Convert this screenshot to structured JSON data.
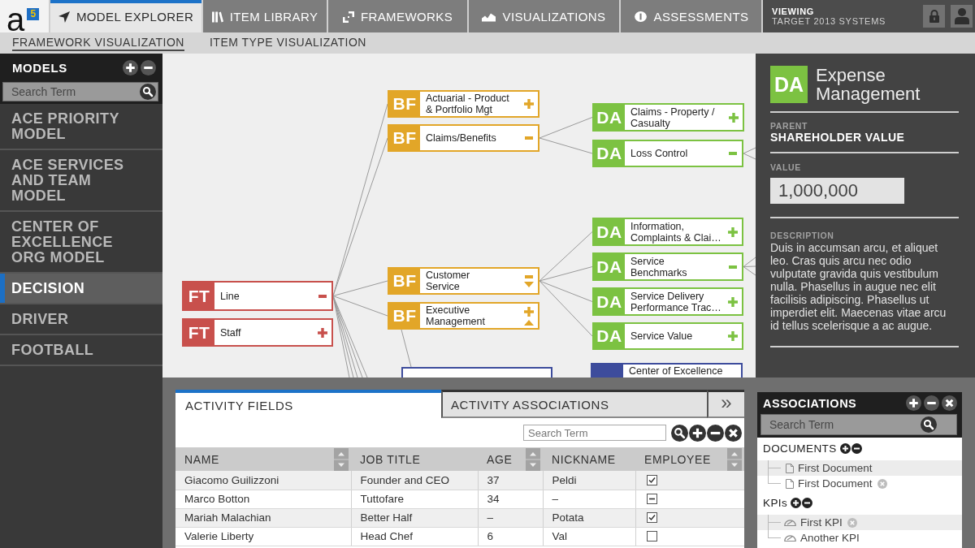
{
  "header": {
    "logo": {
      "letter": "a",
      "badge": "5"
    },
    "tabs": [
      {
        "label": "MODEL EXPLORER",
        "selected": true
      },
      {
        "label": "ITEM LIBRARY",
        "selected": false
      },
      {
        "label": "FRAMEWORKS",
        "selected": false
      },
      {
        "label": "VISUALIZATIONS",
        "selected": false
      },
      {
        "label": "ASSESSMENTS",
        "selected": false
      }
    ],
    "viewing": {
      "label": "VIEWING",
      "value": "TARGET 2013 SYSTEMS"
    }
  },
  "subnav": [
    {
      "label": "FRAMEWORK VISUALIZATION",
      "selected": true
    },
    {
      "label": "ITEM TYPE VISUALIZATION",
      "selected": false
    }
  ],
  "sidebar": {
    "title": "MODELS",
    "search": {
      "placeholder": "Search Term"
    },
    "items": [
      {
        "label": "ACE PRIORITY MODEL",
        "selected": false
      },
      {
        "label": "ACE SERVICES AND TEAM MODEL",
        "selected": false
      },
      {
        "label": "CENTER OF EXCELLENCE ORG MODEL",
        "selected": false
      },
      {
        "label": "DECISION",
        "selected": true
      },
      {
        "label": "DRIVER",
        "selected": false
      },
      {
        "label": "FOOTBALL",
        "selected": false
      }
    ]
  },
  "diagram": {
    "nodes": [
      {
        "kind": "item",
        "badge": "FT",
        "color": "#c8504c",
        "label": "Line",
        "expanded": true,
        "move_down": false,
        "move_up": false
      },
      {
        "kind": "item",
        "badge": "FT",
        "color": "#c8504c",
        "label": "Staff",
        "expanded": false,
        "move_down": false,
        "move_up": false
      },
      {
        "kind": "item",
        "badge": "BF",
        "color": "#e2a628",
        "label": "Actuarial - Product\n& Portfolio Mgt",
        "expanded": false,
        "move_down": false,
        "move_up": false
      },
      {
        "kind": "item",
        "badge": "BF",
        "color": "#e2a628",
        "label": "Claims/Benefits",
        "expanded": true,
        "move_down": false,
        "move_up": false
      },
      {
        "kind": "item",
        "badge": "BF",
        "color": "#e2a628",
        "label": "Customer\nService",
        "expanded": true,
        "move_down": true,
        "move_up": false
      },
      {
        "kind": "item",
        "badge": "BF",
        "color": "#e2a628",
        "label": "Executive\nManagement",
        "expanded": false,
        "move_down": false,
        "move_up": true
      },
      {
        "kind": "item",
        "badge": "DA",
        "color": "#7cc242",
        "label": "Claims - Property /\nCasualty",
        "expanded": false,
        "move_down": false,
        "move_up": false
      },
      {
        "kind": "item",
        "badge": "DA",
        "color": "#7cc242",
        "label": "Loss Control",
        "expanded": true,
        "move_down": false,
        "move_up": false
      },
      {
        "kind": "item",
        "badge": "DA",
        "color": "#7cc242",
        "label": "Information,\nComplaints & Clai…",
        "expanded": false,
        "move_down": false,
        "move_up": false
      },
      {
        "kind": "item",
        "badge": "DA",
        "color": "#7cc242",
        "label": "Service\nBenchmarks",
        "expanded": true,
        "move_down": false,
        "move_up": false
      },
      {
        "kind": "item",
        "badge": "DA",
        "color": "#7cc242",
        "label": "Service Delivery\nPerformance Trac…",
        "expanded": false,
        "move_down": false,
        "move_up": false
      },
      {
        "kind": "item",
        "badge": "DA",
        "color": "#7cc242",
        "label": "Service Value",
        "expanded": false,
        "move_down": false,
        "move_up": false
      },
      {
        "kind": "plain",
        "color": "#3d4c9c"
      },
      {
        "kind": "item",
        "color": "#3d4c9c",
        "label": "Center of Excellence"
      }
    ]
  },
  "detail": {
    "badge": "DA",
    "color": "#7cc242",
    "title": "Expense Management",
    "parent": {
      "label": "PARENT",
      "value": "SHAREHOLDER VALUE"
    },
    "value": {
      "label": "VALUE",
      "value": "1,000,000"
    },
    "description": {
      "label": "DESCRIPTION",
      "text": "Duis in accumsan arcu, et aliquet leo. Cras quis arcu nec odio vulputate gravida quis vestibulum nulla. Phasellus in augue nec elit facilisis adipiscing. Phasellus ut imperdiet elit. Maecenas vitae arcu id tellus scelerisque a ac augue."
    }
  },
  "activity": {
    "tabs": [
      {
        "label": "ACTIVITY FIELDS",
        "selected": true
      },
      {
        "label": "ACTIVITY ASSOCIATIONS",
        "selected": false
      }
    ],
    "more": "»",
    "search": {
      "placeholder": "Search Term"
    },
    "columns": [
      {
        "label": "NAME",
        "sortable": true
      },
      {
        "label": "JOB TITLE",
        "sortable": false
      },
      {
        "label": "AGE",
        "sortable": true
      },
      {
        "label": "NICKNAME",
        "sortable": false
      },
      {
        "label": "EMPLOYEE",
        "sortable": true
      }
    ],
    "rows": [
      {
        "cells": [
          "Giacomo Guilizzoni",
          "Founder and CEO",
          "37",
          "Peldi"
        ],
        "checked": true,
        "indeterminate": false
      },
      {
        "cells": [
          "Marco Botton",
          "Tuttofare",
          "34",
          "–"
        ],
        "checked": false,
        "indeterminate": true
      },
      {
        "cells": [
          "Mariah Malachian",
          "Better Half",
          "–",
          "Potata"
        ],
        "checked": true,
        "indeterminate": false
      },
      {
        "cells": [
          "Valerie Liberty",
          "Head Chef",
          "6",
          "Val"
        ],
        "checked": false,
        "indeterminate": false
      }
    ]
  },
  "associations": {
    "title": "ASSOCIATIONS",
    "search": {
      "placeholder": "Search Term"
    },
    "groups": [
      {
        "label": "DOCUMENTS",
        "kind": "document",
        "items": [
          {
            "label": "First Document",
            "removable": false
          },
          {
            "label": "First Document",
            "removable": true
          }
        ]
      },
      {
        "label": "KPIs",
        "kind": "kpi",
        "items": [
          {
            "label": "First KPI",
            "removable": true
          },
          {
            "label": "Another KPI",
            "removable": false
          }
        ]
      }
    ]
  }
}
